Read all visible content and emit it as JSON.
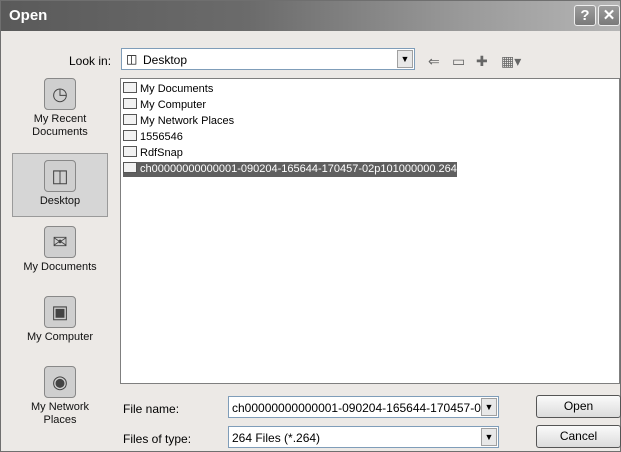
{
  "window": {
    "title": "Open",
    "help_icon": "?",
    "close_icon": "✕"
  },
  "lookin": {
    "label": "Look in:",
    "value": "Desktop"
  },
  "places": [
    {
      "label1": "My Recent",
      "label2": "Documents"
    },
    {
      "label1": "Desktop",
      "label2": ""
    },
    {
      "label1": "My Documents",
      "label2": ""
    },
    {
      "label1": "My Computer",
      "label2": ""
    },
    {
      "label1": "My Network",
      "label2": "Places"
    }
  ],
  "files": [
    {
      "name": "My Documents",
      "icon": "folder-icon"
    },
    {
      "name": "My Computer",
      "icon": "computer-icon"
    },
    {
      "name": "My Network Places",
      "icon": "network-icon"
    },
    {
      "name": "1556546",
      "icon": "folder-icon"
    },
    {
      "name": "RdfSnap",
      "icon": "folder-icon"
    },
    {
      "name": "ch00000000000001-090204-165644-170457-02p101000000.264",
      "icon": "file-icon",
      "selected": true
    }
  ],
  "filename": {
    "label": "File name:",
    "value": "ch00000000000001-090204-165644-170457-0:"
  },
  "filetype": {
    "label": "Files of type:",
    "value": "264 Files (*.264)"
  },
  "buttons": {
    "open": "Open",
    "cancel": "Cancel"
  }
}
